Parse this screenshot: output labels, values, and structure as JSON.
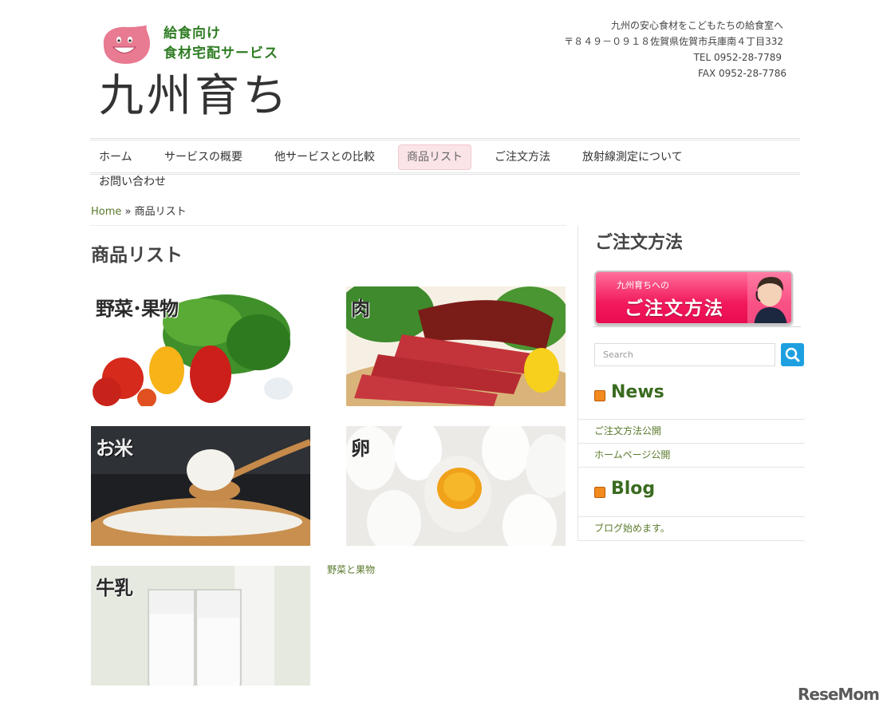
{
  "header": {
    "tagline_line1": "給食向け",
    "tagline_line2": "食材宅配サービス",
    "site_title": "九州育ち",
    "contact": {
      "slogan": "九州の安心食材をこどもたちの給食室へ",
      "address": "〒８４９－０９１８佐賀県佐賀市兵庫南４丁目332",
      "tel": "TEL 0952-28-7789",
      "fax": "FAX 0952-28-7786"
    }
  },
  "nav": {
    "items": [
      {
        "label": "ホーム"
      },
      {
        "label": "サービスの概要"
      },
      {
        "label": "他サービスとの比較"
      },
      {
        "label": "商品リスト",
        "active": true
      },
      {
        "label": "ご注文方法"
      },
      {
        "label": "放射線測定について"
      },
      {
        "label": "お問い合わせ"
      }
    ]
  },
  "breadcrumb": {
    "home": "Home",
    "separator": "»",
    "current": "商品リスト"
  },
  "main": {
    "title": "商品リスト",
    "products": [
      {
        "label": "野菜･果物",
        "icon": "vegetables-image"
      },
      {
        "label": "肉",
        "icon": "meat-image"
      },
      {
        "label": "お米",
        "icon": "rice-image"
      },
      {
        "label": "卵",
        "icon": "eggs-image"
      },
      {
        "label": "牛乳",
        "icon": "milk-image"
      }
    ],
    "link_text": "野菜と果物"
  },
  "sidebar": {
    "order_title": "ご注文方法",
    "order_banner_small": "九州育ちへの",
    "order_banner_big": "ご注文方法",
    "search_placeholder": "Search",
    "news": {
      "title": "News",
      "items": [
        "ご注文方法公開",
        "ホームページ公開"
      ]
    },
    "blog": {
      "title": "Blog",
      "items": [
        "ブログ始めます。"
      ]
    }
  },
  "watermark": "ReseMom",
  "colors": {
    "link_green": "#5a7a2c",
    "widget_green": "#3a6b1f",
    "active_nav_bg": "#fae4e8",
    "search_blue": "#1ea0e0",
    "banner_pink": "#f21a5c",
    "rss_orange": "#f38a1e"
  }
}
